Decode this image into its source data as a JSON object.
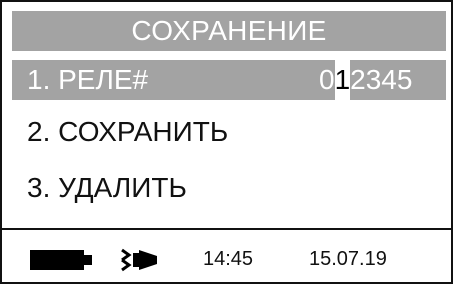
{
  "header": {
    "title": "СОХРАНЕНИЕ"
  },
  "menu": {
    "item1": {
      "label": "1. РЕЛЕ#",
      "value_prefix": "0",
      "value_cursor": "1",
      "value_suffix": "2345"
    },
    "item2": {
      "label": "2. СОХРАНИТЬ"
    },
    "item3": {
      "label": "3. УДАЛИТЬ"
    }
  },
  "status": {
    "battery_icon": "battery-icon",
    "plug_icon": "plug-icon",
    "time": "14:45",
    "date": "15.07.19"
  },
  "colors": {
    "highlight": "#a3a3a3",
    "text": "#111111",
    "background": "#ffffff"
  }
}
